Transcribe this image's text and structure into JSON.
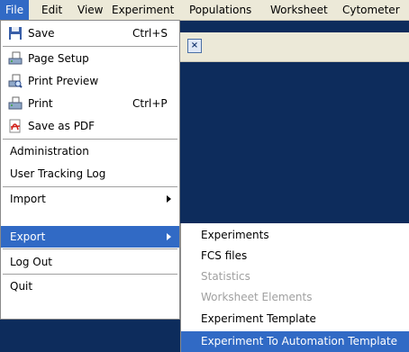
{
  "menubar": {
    "items": [
      {
        "label": "File"
      },
      {
        "label": "Edit"
      },
      {
        "label": "View"
      },
      {
        "label": "Experiment"
      },
      {
        "label": "Populations"
      },
      {
        "label": "Worksheet"
      },
      {
        "label": "Cytometer"
      }
    ]
  },
  "file_menu": {
    "items": [
      {
        "label": "Save",
        "shortcut": "Ctrl+S",
        "icon": "floppy-disk-icon"
      },
      {
        "label": "Page Setup",
        "icon": "page-setup-icon"
      },
      {
        "label": "Print Preview",
        "icon": "print-preview-icon"
      },
      {
        "label": "Print",
        "shortcut": "Ctrl+P",
        "icon": "printer-icon"
      },
      {
        "label": "Save as PDF",
        "icon": "pdf-icon"
      },
      {
        "label": "Administration"
      },
      {
        "label": "User Tracking Log"
      },
      {
        "label": "Import"
      },
      {
        "label": "Export"
      },
      {
        "label": "Log Out"
      },
      {
        "label": "Quit"
      }
    ]
  },
  "export_menu": {
    "items": [
      {
        "label": "Experiments",
        "enabled": true
      },
      {
        "label": "FCS files",
        "enabled": true
      },
      {
        "label": "Statistics",
        "enabled": false
      },
      {
        "label": "Worksheet Elements",
        "enabled": false
      },
      {
        "label": "Experiment Template",
        "enabled": true
      },
      {
        "label": "Experiment To Automation Template",
        "enabled": true
      }
    ]
  },
  "colors": {
    "highlight": "#316ac5",
    "workspace": "#0d2c5c",
    "menubar_bg": "#ece9d8"
  }
}
